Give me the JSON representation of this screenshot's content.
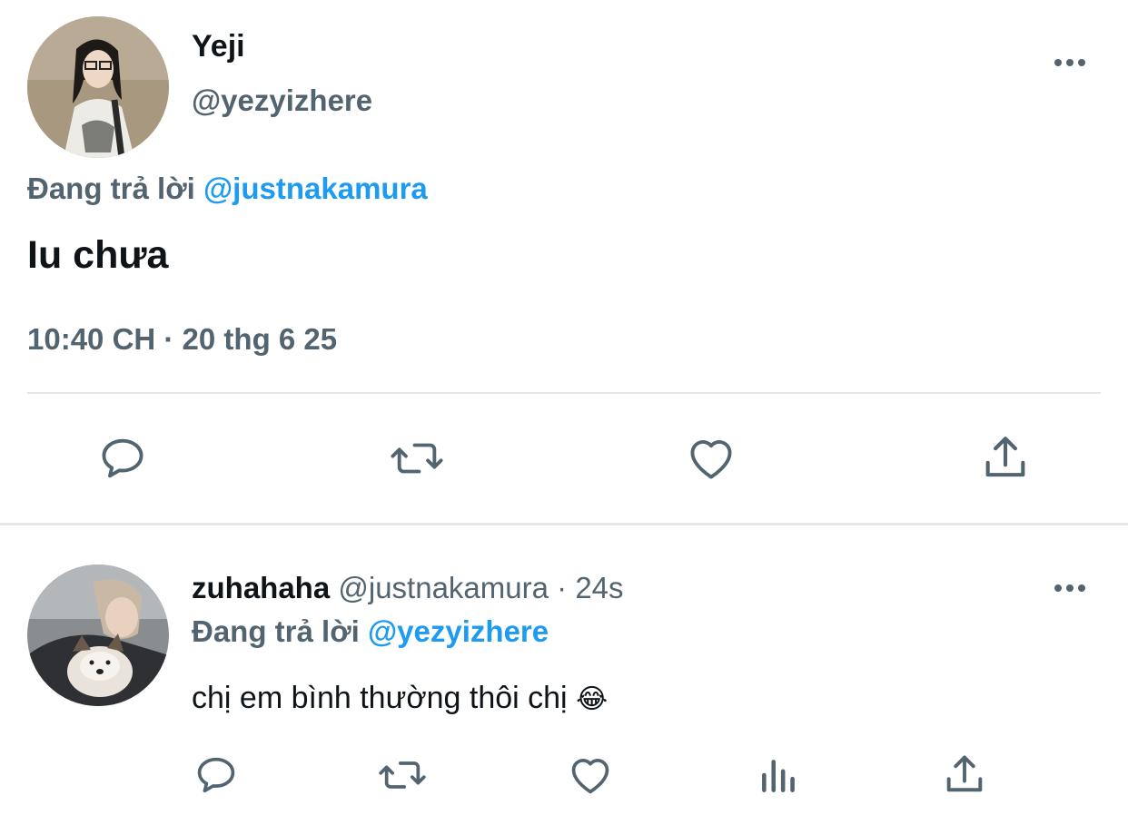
{
  "main_tweet": {
    "display_name": "Yeji",
    "handle": "@yezyizhere",
    "replying_prefix": "Đang trả lời",
    "replying_to": "@justnakamura",
    "text": "Iu chưa",
    "timestamp": "10:40 CH · 20 thg 6 25",
    "actions": [
      "reply-icon",
      "retweet-icon",
      "like-icon",
      "share-icon"
    ]
  },
  "reply_tweet": {
    "display_name": "zuhahaha",
    "handle": "@justnakamura",
    "time_sep": "·",
    "time": "24s",
    "replying_prefix": "Đang trả lời",
    "replying_to": "@yezyizhere",
    "text": "chị em bình thường thôi chị",
    "emoji": "😂",
    "actions": [
      "reply-icon",
      "retweet-icon",
      "like-icon",
      "analytics-icon",
      "share-icon"
    ]
  },
  "colors": {
    "text": "#0f1419",
    "secondary": "#536471",
    "link": "#1d9bf0",
    "divider": "#e6e6e6"
  }
}
